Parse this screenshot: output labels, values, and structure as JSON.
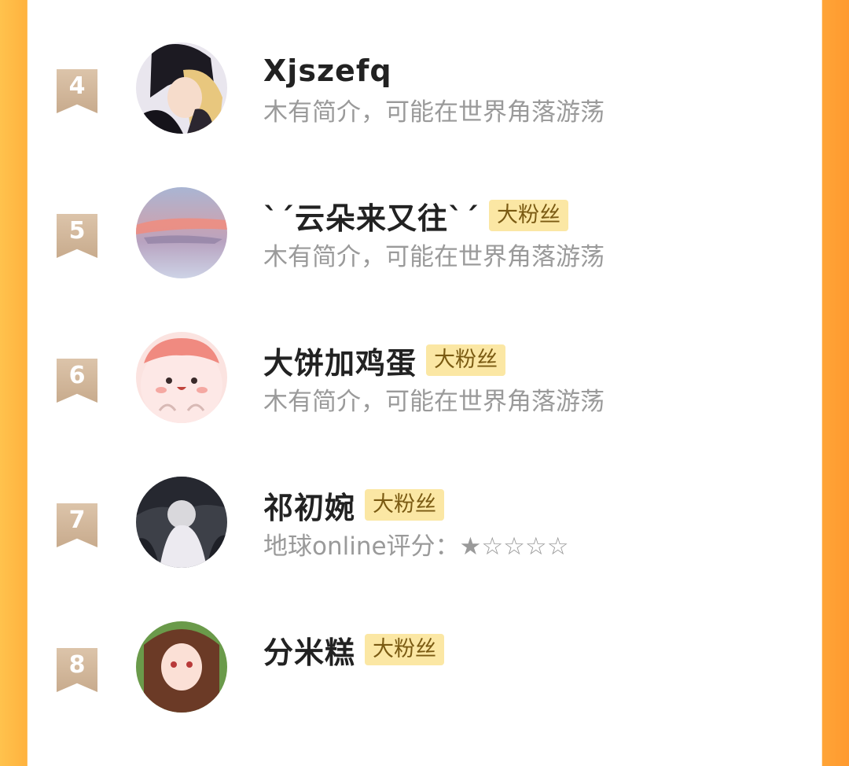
{
  "rows": [
    {
      "rank": "4",
      "name": "Xjszefq",
      "badge": "",
      "desc": "木有简介，可能在世界角落游荡",
      "avatar": "anime-couple-avatar"
    },
    {
      "rank": "5",
      "name": "ˋˊ云朵来又往ˋˊ",
      "badge": "大粉丝",
      "desc": "木有简介，可能在世界角落游荡",
      "avatar": "sunset-sky-avatar"
    },
    {
      "rank": "6",
      "name": "大饼加鸡蛋",
      "badge": "大粉丝",
      "desc": "木有简介，可能在世界角落游荡",
      "avatar": "pink-blob-avatar"
    },
    {
      "rank": "7",
      "name": "祁初婉",
      "badge": "大粉丝",
      "desc": "地球online评分：★☆☆☆☆",
      "avatar": "dark-girl-avatar"
    },
    {
      "rank": "8",
      "name": "分米糕",
      "badge": "大粉丝",
      "desc": "",
      "avatar": "anime-girl-avatar"
    }
  ],
  "colors": {
    "side_accent": "#ffb23e",
    "rank_badge": "#c8ab8d",
    "fan_badge_bg": "#fbe7a4"
  }
}
